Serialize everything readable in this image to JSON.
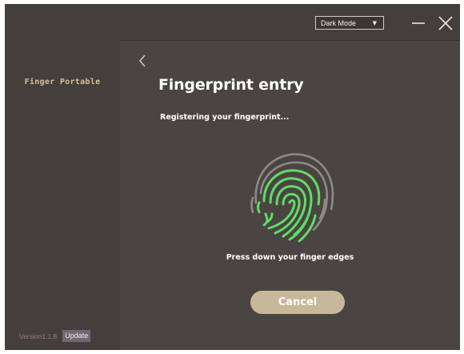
{
  "app": {
    "name": "Finger Portable",
    "version": "Version1.1.8",
    "update_label": "Update"
  },
  "titlebar": {
    "theme_select": {
      "value": "Dark Mode",
      "caret": "▼"
    }
  },
  "page": {
    "title": "Fingerprint entry",
    "status": "Registering your fingerprint...",
    "instruction": "Press down your finger edges",
    "cancel_label": "Cancel"
  },
  "icons": {
    "back": "chevron-left-icon",
    "minimize": "minimize-icon",
    "close": "close-icon",
    "fingerprint": "fingerprint-icon"
  },
  "colors": {
    "window_bg": "#4a4442",
    "sidebar_bg": "#443e3c",
    "accent_gold": "#d8c09a",
    "fingerprint_progress": "#5ede63",
    "fingerprint_base": "#8f8a86",
    "cancel_button": "#c8b89a"
  }
}
